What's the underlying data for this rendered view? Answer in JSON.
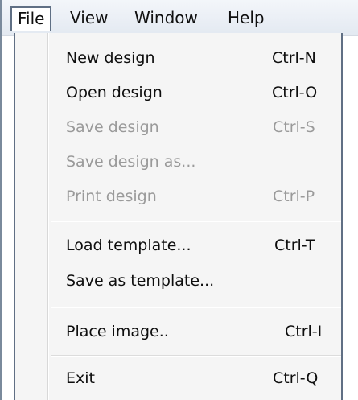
{
  "menubar": {
    "file": "File",
    "view": "View",
    "window": "Window",
    "help": "Help"
  },
  "file_menu": {
    "new_design": {
      "label": "New design",
      "shortcut": "Ctrl-N",
      "enabled": true
    },
    "open_design": {
      "label": "Open design",
      "shortcut": "Ctrl-O",
      "enabled": true
    },
    "save_design": {
      "label": "Save design",
      "shortcut": "Ctrl-S",
      "enabled": false
    },
    "save_design_as": {
      "label": "Save design as...",
      "shortcut": "",
      "enabled": false
    },
    "print_design": {
      "label": "Print design",
      "shortcut": "Ctrl-P",
      "enabled": false
    },
    "load_template": {
      "label": "Load template...",
      "shortcut": "Ctrl-T",
      "enabled": true
    },
    "save_as_template": {
      "label": "Save as template...",
      "shortcut": "",
      "enabled": true
    },
    "place_image": {
      "label": "Place image..",
      "shortcut": "Ctrl-I",
      "enabled": true
    },
    "exit": {
      "label": "Exit",
      "shortcut": "Ctrl-Q",
      "enabled": true
    }
  },
  "colors": {
    "disabled_text": "#9a9a9a",
    "menu_background": "#f5f5f5",
    "menu_border": "#606f84"
  }
}
